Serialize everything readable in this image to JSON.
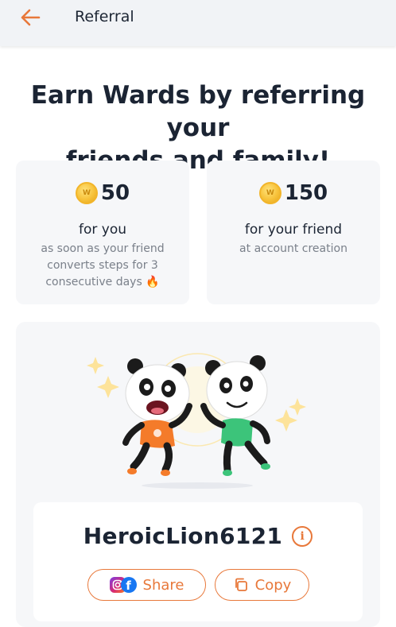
{
  "header": {
    "back_icon": "arrow-left-icon",
    "title": "Referral"
  },
  "headline": {
    "line1": "Earn Wards by referring your",
    "line2": "friends and family!"
  },
  "reward_you": {
    "coin_icon": "ward-coin-icon",
    "amount": "50",
    "title": "for you",
    "line1": "as soon as your friend",
    "line2": "converts steps for 3",
    "line3": "consecutive days",
    "emoji": "🔥"
  },
  "reward_friend": {
    "coin_icon": "ward-coin-icon",
    "amount": "150",
    "title": "for your friend",
    "subtitle": "at account creation"
  },
  "referral": {
    "code": "HeroicLion6121",
    "info_icon": "info-icon",
    "share_label": "Share",
    "copy_label": "Copy"
  },
  "colors": {
    "accent": "#e8783a",
    "text_dark": "#1b2433",
    "text_muted": "#7a808a",
    "card_bg": "#f6f7f9",
    "coin": "#f7c23a"
  }
}
